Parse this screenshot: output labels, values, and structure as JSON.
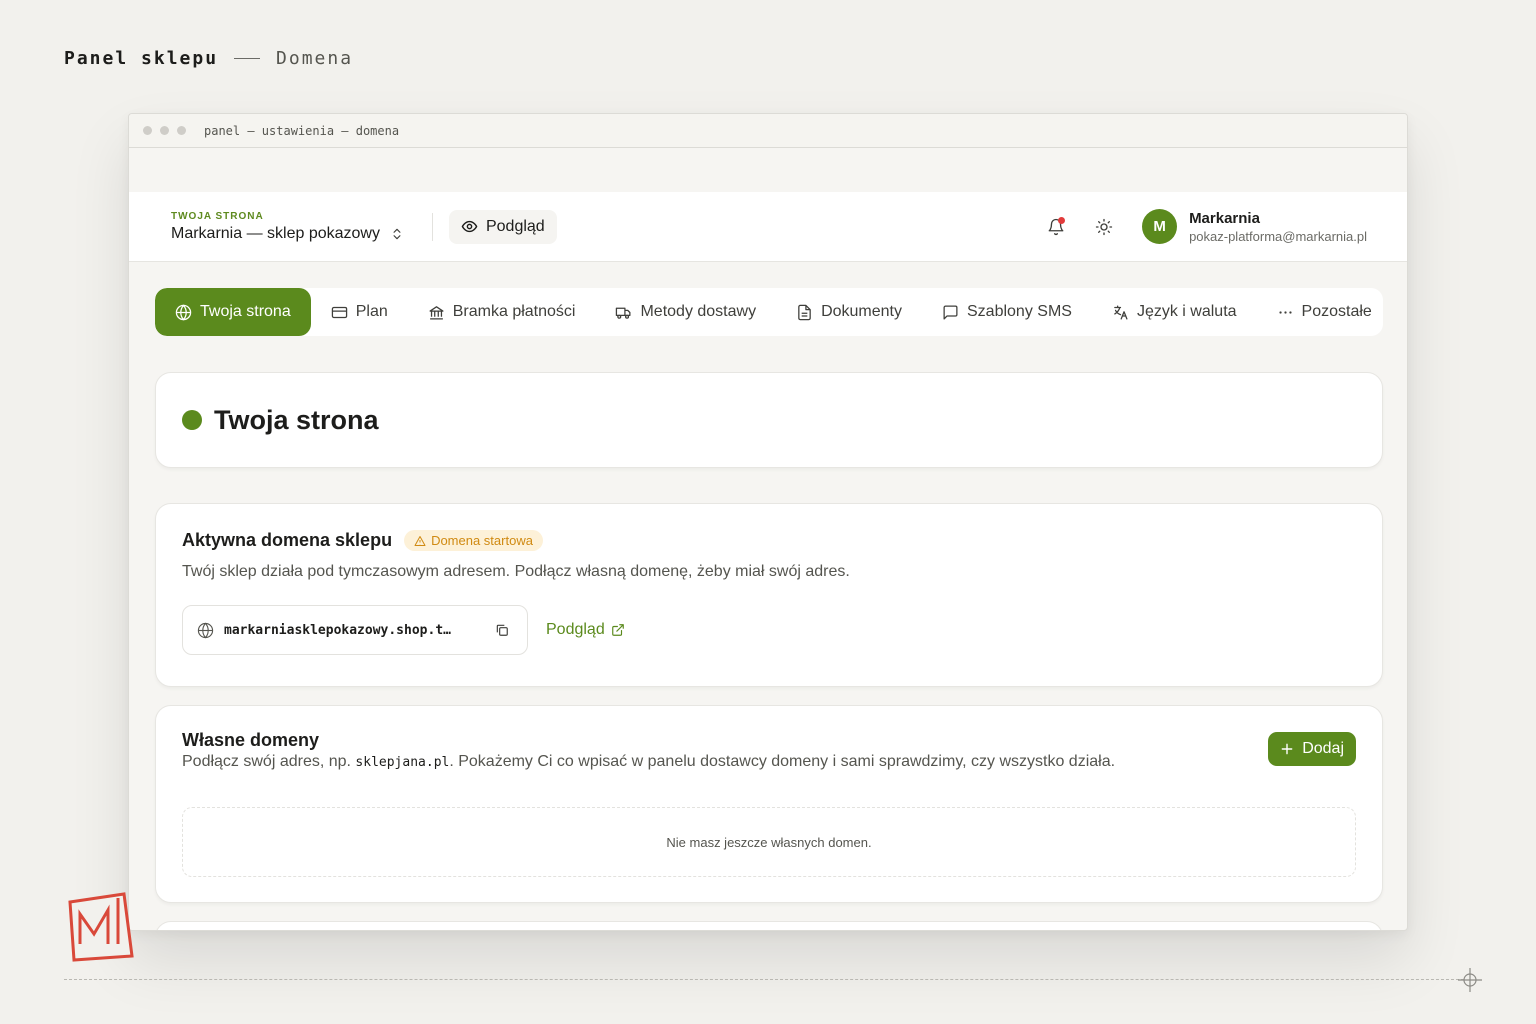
{
  "header": {
    "title": "Panel sklepu",
    "subtitle": "Domena"
  },
  "window": {
    "path": "panel — ustawienia — domena"
  },
  "topbar": {
    "site_eyebrow": "TWOJA STRONA",
    "site_name": "Markarnia — sklep pokazowy",
    "preview_label": "Podgląd",
    "user": {
      "initial": "M",
      "name": "Markarnia",
      "email": "pokaz-platforma@markarnia.pl"
    }
  },
  "tabs": [
    {
      "label": "Twoja strona",
      "icon": "globe-icon",
      "active": true
    },
    {
      "label": "Plan",
      "icon": "card-icon"
    },
    {
      "label": "Bramka płatności",
      "icon": "bank-icon"
    },
    {
      "label": "Metody dostawy",
      "icon": "truck-icon"
    },
    {
      "label": "Dokumenty",
      "icon": "document-icon"
    },
    {
      "label": "Szablony SMS",
      "icon": "chat-icon"
    },
    {
      "label": "Język i waluta",
      "icon": "translate-icon"
    },
    {
      "label": "Pozostałe",
      "icon": "more-icon"
    }
  ],
  "page_title": "Twoja strona",
  "active_domain": {
    "title": "Aktywna domena sklepu",
    "badge": "Domena startowa",
    "description": "Twój sklep działa pod tymczasowym adresem. Podłącz własną domenę, żeby miał swój adres.",
    "domain": "markarniasklepokazowy.shop.t…",
    "preview_link": "Podgląd"
  },
  "own_domains": {
    "title": "Własne domeny",
    "desc_before": "Podłącz swój adres, np. ",
    "desc_code": "sklepjana.pl",
    "desc_after": ". Pokażemy Ci co wpisać w panelu dostawcy domeny i sami sprawdzimy, czy wszystko działa.",
    "add_label": "Dodaj",
    "empty_text": "Nie masz jeszcze własnych domen."
  },
  "colors": {
    "accent": "#5b8a1d",
    "badge_bg": "#fdf1d8",
    "badge_fg": "#d08a12",
    "notification": "#e23b3b",
    "logo": "#d9493a"
  }
}
